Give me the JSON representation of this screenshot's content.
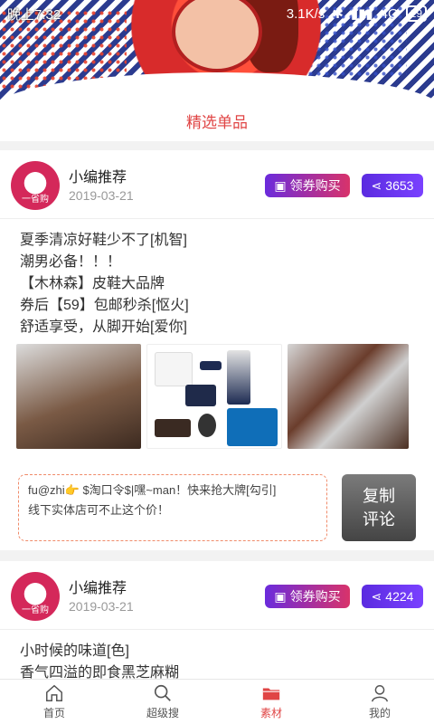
{
  "status_bar": {
    "time": "晚上7:32",
    "network_speed": "3.1K/s",
    "network_type": "4G",
    "battery": "29"
  },
  "section": {
    "title": "精选单品"
  },
  "posts": [
    {
      "author": "小编推荐",
      "avatar_text": "一省购",
      "date": "2019-03-21",
      "coupon_label": "领券购买",
      "share_count": "3653",
      "lines": [
        "夏季清凉好鞋少不了[机智]",
        "潮男必备！！！",
        "【木林森】皮鞋大品牌",
        "券后【59】包邮秒杀[怄火]",
        "舒适享受，从脚开始[爱你]"
      ],
      "command_line1": "fu@zhi👉 $淘口令$|嘿~man！快来抢大牌[勾引]",
      "command_line2": "线下实体店可不止这个价！",
      "copy_label_line1": "复制",
      "copy_label_line2": "评论"
    },
    {
      "author": "小编推荐",
      "avatar_text": "一省购",
      "date": "2019-03-21",
      "coupon_label": "领券购买",
      "share_count": "4224",
      "lines": [
        "小时候的味道[色]",
        "香气四溢的即食黑芝麻糊"
      ]
    }
  ],
  "nav": {
    "items": [
      {
        "label": "首页",
        "icon": "home-icon"
      },
      {
        "label": "超级搜",
        "icon": "search-icon"
      },
      {
        "label": "素材",
        "icon": "folder-icon"
      },
      {
        "label": "我的",
        "icon": "user-icon"
      }
    ],
    "active": 2
  },
  "colors": {
    "accent": "#e04545",
    "coupon_gradient": [
      "#6b2bdc",
      "#d8336a"
    ],
    "share_gradient": [
      "#5b2be0",
      "#7a41ff"
    ]
  }
}
